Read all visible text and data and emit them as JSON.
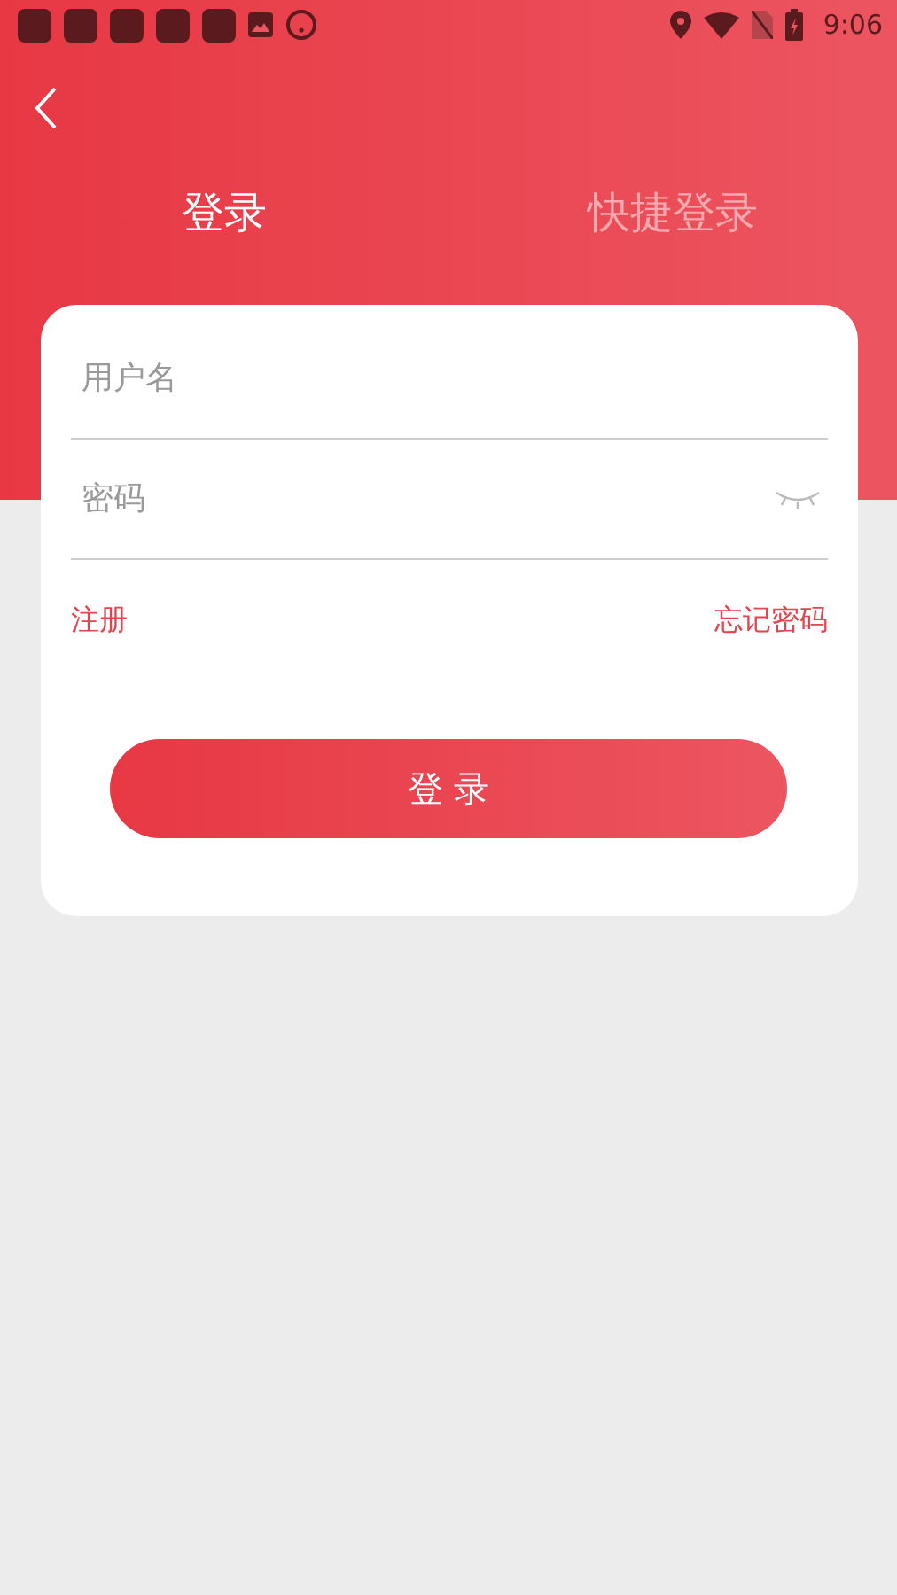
{
  "status_bar": {
    "time": "9:06"
  },
  "tabs": [
    {
      "label": "登录",
      "selected": true
    },
    {
      "label": "快捷登录",
      "selected": false
    }
  ],
  "form": {
    "username": {
      "placeholder": "用户名"
    },
    "password": {
      "placeholder": "密码",
      "visible": false
    },
    "register_link": "注册",
    "forgot_link": "忘记密码",
    "submit": "登 录"
  }
}
